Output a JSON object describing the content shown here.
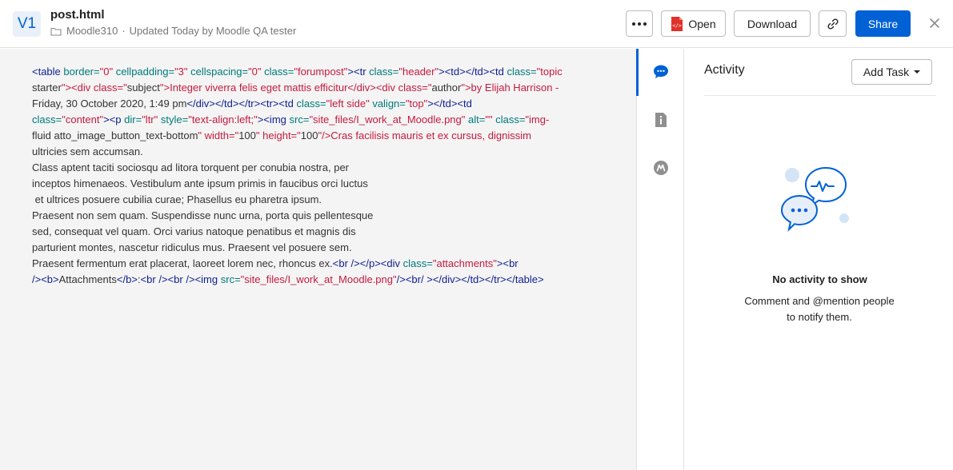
{
  "header": {
    "version_badge": "V1",
    "file_name": "post.html",
    "folder_icon": "folder-icon",
    "folder_name": "Moodle310",
    "separator": "·",
    "updated_text": "Updated Today by Moodle QA tester",
    "more_icon": "more-dots-icon",
    "open_label": "Open",
    "download_label": "Download",
    "link_icon": "link-icon",
    "share_label": "Share",
    "close_icon": "close-icon"
  },
  "preview": {
    "source_lines": [
      "<table border=\"0\" cellpadding=\"3\" cellspacing=\"0\" class=\"forumpost\"><tr class=\"header\"><td></td><td class=\"topic",
      "starter\"><div class=\"subject\">Integer viverra felis eget mattis efficitur</div><div class=\"author\">by Elijah Harrison -",
      "Friday, 30 October 2020, 1:49 pm</div></td></tr><tr><td class=\"left side\" valign=\"top\"></td><td",
      "class=\"content\"><p dir=\"ltr\" style=\"text-align:left;\"><img src=\"site_files/I_work_at_Moodle.png\" alt=\"\" class=\"img-",
      "fluid atto_image_button_text-bottom\" width=\"100\" height=\"100\"/>Cras facilisis mauris et ex cursus, dignissim",
      "ultricies sem accumsan.",
      "Class aptent taciti sociosqu ad litora torquent per conubia nostra, per",
      "inceptos himenaeos. Vestibulum ante ipsum primis in faucibus orci luctus",
      " et ultrices posuere cubilia curae; Phasellus eu pharetra ipsum.",
      "Praesent non sem quam. Suspendisse nunc urna, porta quis pellentesque",
      "sed, consequat vel quam. Orci varius natoque penatibus et magnis dis",
      "parturient montes, nascetur ridiculus mus. Praesent vel posuere sem.",
      "Praesent fermentum erat placerat, laoreet lorem nec, rhoncus ex.<br /></p><div class=\"attachments\"><br",
      "/><b>Attachments</b>:<br /><br /><img src=\"site_files/I_work_at_Moodle.png\"/><br/ ></div></td></tr></table>"
    ],
    "syntax_colors": {
      "tag": "#0d1e91",
      "attribute": "#007979",
      "value": "#c41a3f",
      "text": "#333333"
    }
  },
  "side_nav": {
    "items": [
      {
        "icon": "activity-chat-icon",
        "active": true
      },
      {
        "icon": "details-info-icon",
        "active": false
      },
      {
        "icon": "metadata-m-icon",
        "active": false
      }
    ]
  },
  "activity": {
    "title": "Activity",
    "add_task_label": "Add Task",
    "empty_icon": "conversation-bubbles-icon",
    "empty_title": "No activity to show",
    "empty_text": "Comment and @mention people to notify them."
  },
  "colors": {
    "accent": "#0061d5",
    "badge_bg": "#e9f0f9",
    "preview_bg": "#f4f4f4",
    "muted_text": "#767676"
  }
}
